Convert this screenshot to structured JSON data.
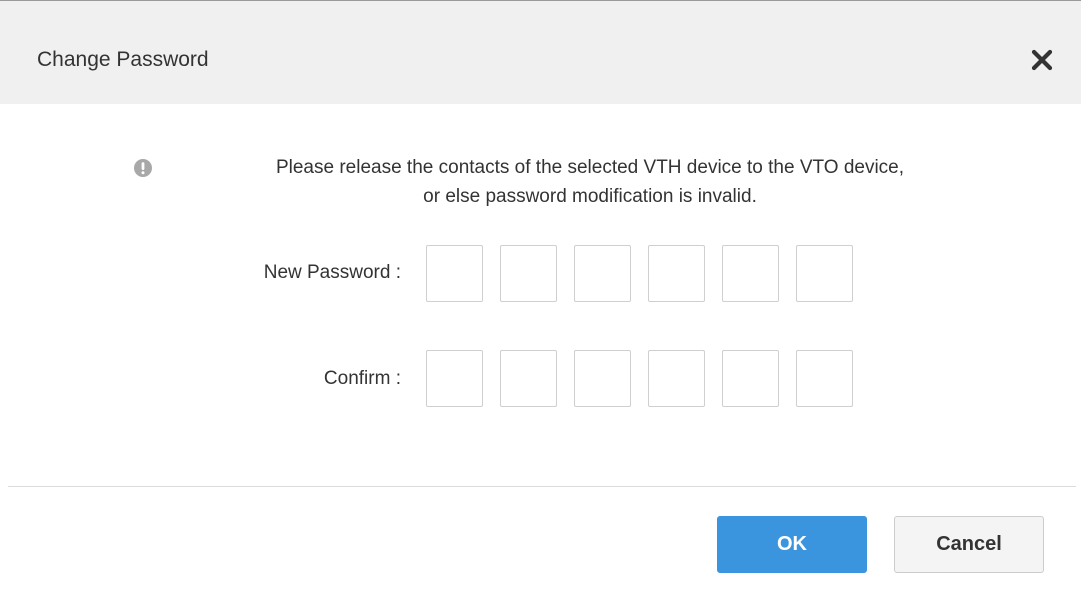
{
  "dialog": {
    "title": "Change Password",
    "close_icon": "close-x-icon"
  },
  "notice": {
    "icon": "exclamation-circle-icon",
    "line1": "Please release the contacts of the selected VTH device to the VTO device,",
    "line2": "or else password modification is invalid."
  },
  "form": {
    "new_password_label": "New Password :",
    "confirm_label": "Confirm :",
    "new_password_digits": [
      "",
      "",
      "",
      "",
      "",
      ""
    ],
    "confirm_digits": [
      "",
      "",
      "",
      "",
      "",
      ""
    ]
  },
  "footer": {
    "ok_label": "OK",
    "cancel_label": "Cancel"
  },
  "colors": {
    "header_bg": "#f0f0f0",
    "primary": "#3b95de",
    "text": "#333333",
    "icon_gray": "#a8a8a8"
  }
}
